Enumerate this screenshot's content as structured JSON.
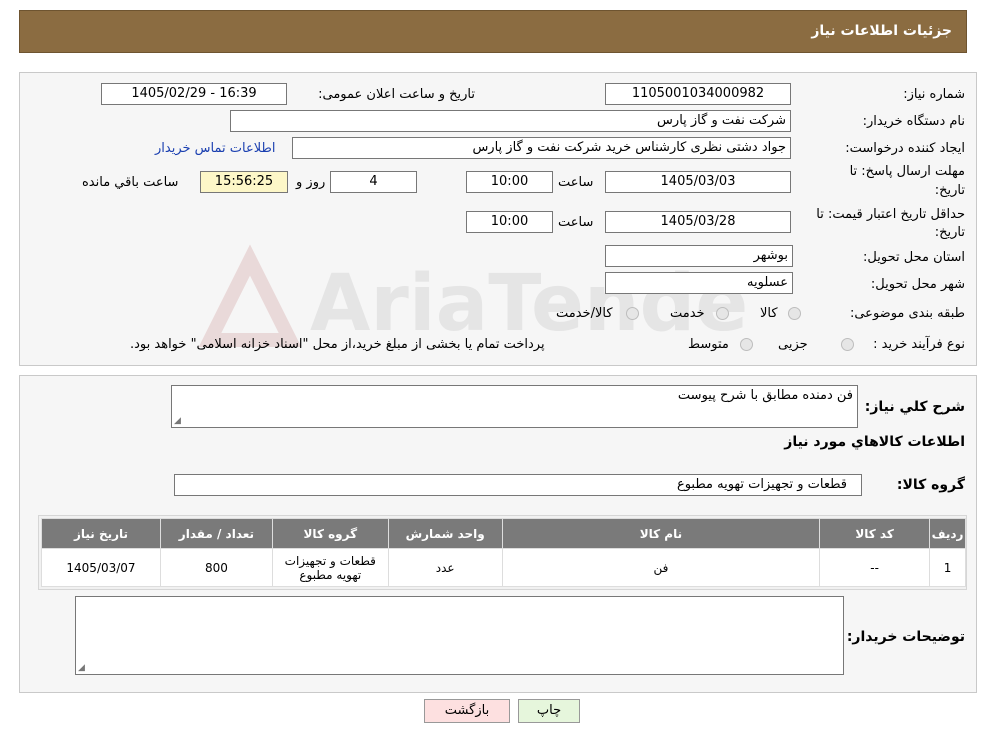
{
  "header": {
    "title": "جزئیات اطلاعات نیاز"
  },
  "form": {
    "need_number_label": "شماره نیاز:",
    "need_number": "1105001034000982",
    "announce_label": "تاریخ و ساعت اعلان عمومی:",
    "announce_value": "1405/02/29 - 16:39",
    "buyer_org_label": "نام دستگاه خریدار:",
    "buyer_org": "شرکت نفت و گاز پارس",
    "requester_label": "ایجاد کننده درخواست:",
    "requester": "جواد دشتی نظری کارشناس خرید  شرکت نفت و گاز پارس",
    "contact_link": "اطلاعات تماس خریدار",
    "deadline_label_1": "مهلت ارسال پاسخ: تا",
    "deadline_label_2": "تاریخ:",
    "deadline_date": "1405/03/03",
    "time_label": "ساعت",
    "deadline_time": "10:00",
    "days_value": "4",
    "days_label": "روز و",
    "remaining_time": "15:56:25",
    "remaining_label": "ساعت باقي مانده",
    "validity_label_1": "حداقل تاریخ اعتبار قیمت: تا",
    "validity_label_2": "تاریخ:",
    "validity_date": "1405/03/28",
    "validity_time": "10:00",
    "province_label": "استان محل تحویل:",
    "province": "بوشهر",
    "city_label": "شهر محل تحویل:",
    "city": "عسلویه",
    "category_label": "طبقه بندی موضوعی:",
    "category_options": [
      "کالا",
      "خدمت",
      "کالا/خدمت"
    ],
    "process_label": "نوع فرآیند خرید :",
    "process_options": [
      "جزیی",
      "متوسط"
    ],
    "process_note": "پرداخت تمام یا بخشی از مبلغ خرید،از محل \"اسناد خزانه اسلامی\" خواهد بود."
  },
  "details": {
    "description_label": "شرح کلي نياز:",
    "description": "فن دمنده مطابق با شرح پیوست",
    "goods_info_title": "اطلاعات کالاهاي مورد نياز",
    "goods_group_label": "گروه کالا:",
    "goods_group": "قطعات و تجهیزات تهویه مطبوع",
    "table": {
      "headers": [
        "رديف",
        "کد کالا",
        "نام کالا",
        "واحد شمارش",
        "گروه کالا",
        "تعداد / مقدار",
        "تاریخ نیاز"
      ],
      "rows": [
        [
          "1",
          "--",
          "فن",
          "عدد",
          "قطعات و تجهیزات تهویه مطبوع",
          "800",
          "1405/03/07"
        ]
      ]
    },
    "buyer_notes_label": "توضیحات خریدار:",
    "buyer_notes": ""
  },
  "buttons": {
    "print": "چاپ",
    "back": "بازگشت"
  },
  "watermark": {
    "text": "AriaTender.neT"
  },
  "colors": {
    "header_bg": "#8b6c41",
    "table_header_bg": "#7a7a7a",
    "back_button_bg": "#fde0e0",
    "print_button_bg": "#e6f6dc",
    "remaining_bg": "#fdf7c8"
  }
}
